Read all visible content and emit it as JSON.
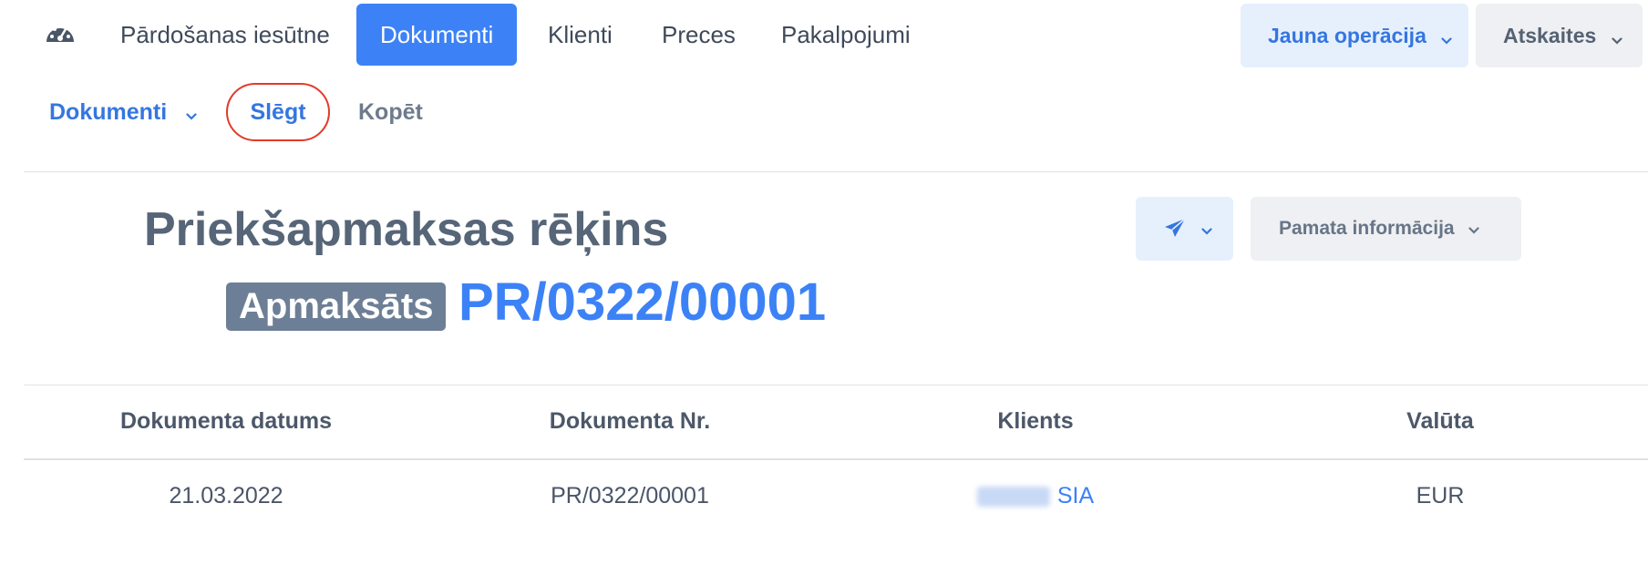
{
  "topnav": {
    "dashboard_icon": "speedometer-icon",
    "items": [
      {
        "label": "Pārdošanas iesūtne",
        "active": false
      },
      {
        "label": "Dokumenti",
        "active": true
      },
      {
        "label": "Klienti",
        "active": false
      },
      {
        "label": "Preces",
        "active": false
      },
      {
        "label": "Pakalpojumi",
        "active": false
      }
    ],
    "new_operation_label": "Jauna operācija",
    "reports_label": "Atskaites"
  },
  "subnav": {
    "documents_label": "Dokumenti",
    "close_label": "Slēgt",
    "copy_label": "Kopēt"
  },
  "document": {
    "title": "Priekšapmaksas rēķins",
    "status": "Apmaksāts",
    "number": "PR/0322/00001",
    "send_icon": "paper-plane-icon",
    "info_label": "Pamata informācija"
  },
  "table": {
    "headers": [
      "Dokumenta datums",
      "Dokumenta Nr.",
      "Klients",
      "Valūta"
    ],
    "row": {
      "date": "21.03.2022",
      "number": "PR/0322/00001",
      "client": "SIA",
      "currency": "EUR"
    }
  },
  "colors": {
    "accent": "#3c82f6",
    "badge": "#6d7f96",
    "highlight_ring": "#e23b2a"
  }
}
